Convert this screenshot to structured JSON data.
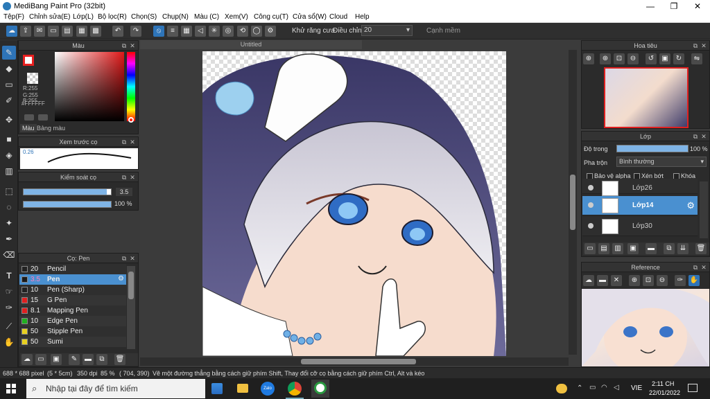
{
  "app": {
    "title": "MediBang Paint Pro (32bit)"
  },
  "window": {
    "minimize": "—",
    "maximize": "❐",
    "close": "✕"
  },
  "menu": [
    "Tệp(F)",
    "Chỉnh sửa(E)",
    "Lớp(L)",
    "Bộ lọc(R)",
    "Chọn(S)",
    "Chụp(N)",
    "Màu (C)",
    "Xem(V)",
    "Công cụ(T)",
    "Cửa sổ(W)",
    "Cloud",
    "Help"
  ],
  "toolbar": {
    "antialias_label": "Khử răng cưa",
    "adjust_label": "Điều chỉnh",
    "adjust_value": "20",
    "snap_label": "Cạnh mềm"
  },
  "color_panel": {
    "title": "Màu",
    "r": "R:255",
    "g": "G:255",
    "b": "B:255",
    "hex": "#FFFFFF",
    "tab_color": "Màu",
    "tab_palette": "Bảng màu"
  },
  "brush_preview": {
    "title": "Xem trước cọ",
    "size": "0.26"
  },
  "brush_control": {
    "title": "Kiểm soát cọ",
    "size_value": "3.5",
    "opacity_value": "100 %",
    "size_fill": 0.95,
    "opacity_fill": 1.0
  },
  "brush_panel": {
    "title": "Cọ: Pen",
    "items": [
      {
        "size": "20",
        "name": "Pencil",
        "color": "#222222"
      },
      {
        "size": "3.5",
        "name": "Pen",
        "color": "#1a1a1a",
        "selected": true
      },
      {
        "size": "10",
        "name": "Pen (Sharp)",
        "color": "#222222"
      },
      {
        "size": "15",
        "name": "G Pen",
        "color": "#e02020"
      },
      {
        "size": "8.1",
        "name": "Mapping Pen",
        "color": "#e02020"
      },
      {
        "size": "10",
        "name": "Edge Pen",
        "color": "#20b020"
      },
      {
        "size": "50",
        "name": "Stipple Pen",
        "color": "#e8d020"
      },
      {
        "size": "50",
        "name": "Sumi",
        "color": "#e8d020"
      }
    ]
  },
  "canvas": {
    "tab": "Untitled"
  },
  "navigator": {
    "title": "Hoa tiêu"
  },
  "layer_panel": {
    "title": "Lớp",
    "opacity_label": "Độ trong",
    "opacity_value": "100 %",
    "opacity_fill": 1.0,
    "blend_label": "Pha trộn",
    "blend_value": "Bình thường",
    "protect_alpha": "Bảo vệ alpha",
    "clip": "Xén bớt",
    "lock": "Khóa",
    "layers": [
      {
        "name": "Lớp26"
      },
      {
        "name": "Lớp14",
        "selected": true
      },
      {
        "name": "Lớp30"
      }
    ]
  },
  "reference": {
    "title": "Reference"
  },
  "status": {
    "size": "688 * 688 pixel",
    "cm": "(5 * 5cm)",
    "dpi": "350 dpi",
    "zoom": "85 %",
    "coords": "( 704, 390)",
    "hint": "Vẽ một đường thẳng bằng cách giữ phím Shift, Thay đổi cỡ cọ bằng cách giữ phím Ctrl, Alt và kéo"
  },
  "taskbar": {
    "search_placeholder": "Nhập tại đây để tìm kiếm",
    "lang": "VIE",
    "time": "2:11 CH",
    "date": "22/01/2022",
    "zalo": "Zalo"
  },
  "colors": {
    "accent": "#2e74b8",
    "selected_layer": "#4a90d0"
  }
}
